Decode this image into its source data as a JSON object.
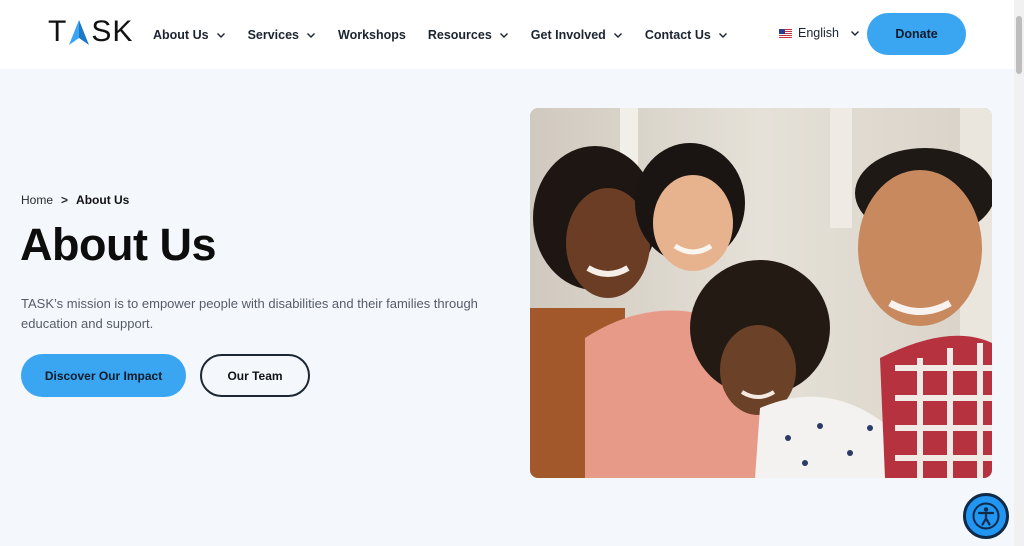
{
  "brand": {
    "logo_text_left": "T",
    "logo_text_right": "SK",
    "logo_alt": "TASK"
  },
  "nav": {
    "items": [
      {
        "label": "About Us",
        "has_dropdown": true
      },
      {
        "label": "Services",
        "has_dropdown": true
      },
      {
        "label": "Workshops",
        "has_dropdown": false
      },
      {
        "label": "Resources",
        "has_dropdown": true
      },
      {
        "label": "Get Involved",
        "has_dropdown": true
      },
      {
        "label": "Contact Us",
        "has_dropdown": true
      }
    ],
    "language": "English",
    "donate_label": "Donate"
  },
  "hero": {
    "breadcrumb": {
      "home": "Home",
      "separator": ">",
      "current": "About Us"
    },
    "title": "About Us",
    "mission": "TASK’s mission is to empower people with disabilities and their families through education and support.",
    "primary_cta": "Discover Our Impact",
    "secondary_cta": "Our Team"
  },
  "colors": {
    "accent": "#3aa5f1",
    "page_bg": "#f4f8fd",
    "text_dark": "#0d0d0d",
    "outline": "#1d2733",
    "a11y_blue": "#2196f3"
  },
  "icons": {
    "chevron": "chevron-down-icon",
    "flag": "us-flag-icon",
    "accessibility": "accessibility-icon"
  }
}
